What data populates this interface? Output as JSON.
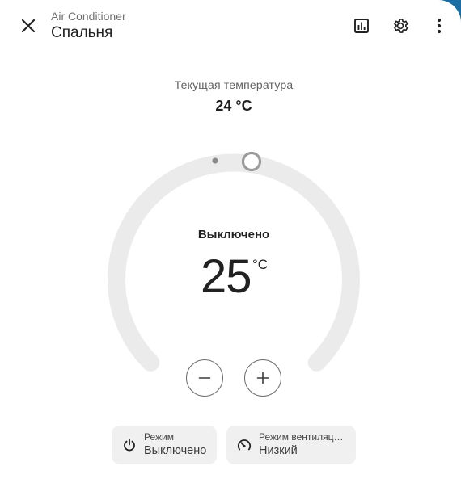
{
  "header": {
    "subtitle": "Air Conditioner",
    "title": "Спальня",
    "close_icon": "close-icon",
    "history_icon": "chart-icon",
    "settings_icon": "gear-icon",
    "more_icon": "more-vertical-icon"
  },
  "current": {
    "label": "Текущая температура",
    "value": "24 °C"
  },
  "thermostat": {
    "state": "Выключено",
    "target": "25",
    "unit": "°C",
    "decrease_icon": "minus-icon",
    "increase_icon": "plus-icon"
  },
  "chips": [
    {
      "icon": "power-icon",
      "label": "Режим",
      "value": "Выключено"
    },
    {
      "icon": "fan-speed-icon",
      "label": "Режим вентиляц…",
      "value": "Низкий"
    }
  ],
  "colors": {
    "track": "#ebebeb",
    "handle": "#9b9b9b",
    "text": "#212121",
    "chip_bg": "#f0f0f0",
    "frame": "#1a6ea3"
  }
}
